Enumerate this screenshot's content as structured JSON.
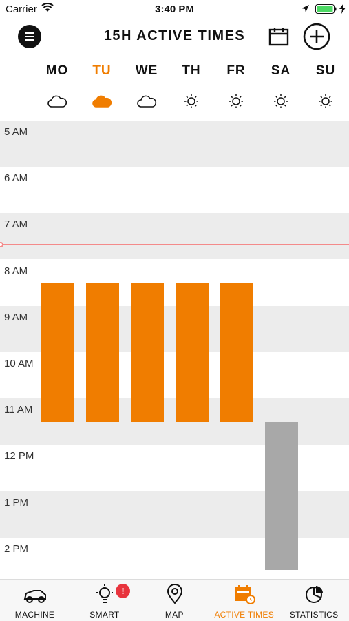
{
  "status": {
    "carrier": "Carrier",
    "time": "3:40 PM"
  },
  "header": {
    "title": "15H ACTIVE TIMES",
    "menu_icon": "hamburger-menu-icon",
    "calendar_icon": "calendar-icon",
    "add_icon": "plus-circle-icon"
  },
  "days": [
    {
      "label": "MO",
      "weather": "cloud",
      "active": false
    },
    {
      "label": "TU",
      "weather": "cloud",
      "active": true
    },
    {
      "label": "WE",
      "weather": "cloud",
      "active": false
    },
    {
      "label": "TH",
      "weather": "sun",
      "active": false
    },
    {
      "label": "FR",
      "weather": "sun",
      "active": false
    },
    {
      "label": "SA",
      "weather": "sun",
      "active": false
    },
    {
      "label": "SU",
      "weather": "sun",
      "active": false
    }
  ],
  "hours": [
    "5 AM",
    "6 AM",
    "7 AM",
    "8 AM",
    "9 AM",
    "10 AM",
    "11 AM",
    "12 PM",
    "1 PM",
    "2 PM"
  ],
  "schedule": [
    {
      "day": "MO",
      "start_hour": 8.5,
      "end_hour": 11.5,
      "state": "active"
    },
    {
      "day": "TU",
      "start_hour": 8.5,
      "end_hour": 11.5,
      "state": "active"
    },
    {
      "day": "WE",
      "start_hour": 8.5,
      "end_hour": 11.5,
      "state": "active"
    },
    {
      "day": "TH",
      "start_hour": 8.5,
      "end_hour": 11.5,
      "state": "active"
    },
    {
      "day": "FR",
      "start_hour": 8.5,
      "end_hour": 11.5,
      "state": "active"
    },
    {
      "day": "SA",
      "start_hour": 11.5,
      "end_hour": 15.5,
      "state": "inactive"
    }
  ],
  "current_time_hour": 7.67,
  "colors": {
    "accent": "#f07d00",
    "inactive_block": "#a8a8a8",
    "now_line": "#f48a8a",
    "badge": "#e8343d"
  },
  "tabs": [
    {
      "label": "MACHINE",
      "icon": "mower-icon",
      "active": false
    },
    {
      "label": "SMART",
      "icon": "lightbulb-icon",
      "active": false,
      "badge": "!"
    },
    {
      "label": "MAP",
      "icon": "map-pin-icon",
      "active": false
    },
    {
      "label": "ACTIVE TIMES",
      "icon": "calendar-clock-icon",
      "active": true
    },
    {
      "label": "STATISTICS",
      "icon": "pie-chart-icon",
      "active": false
    }
  ]
}
